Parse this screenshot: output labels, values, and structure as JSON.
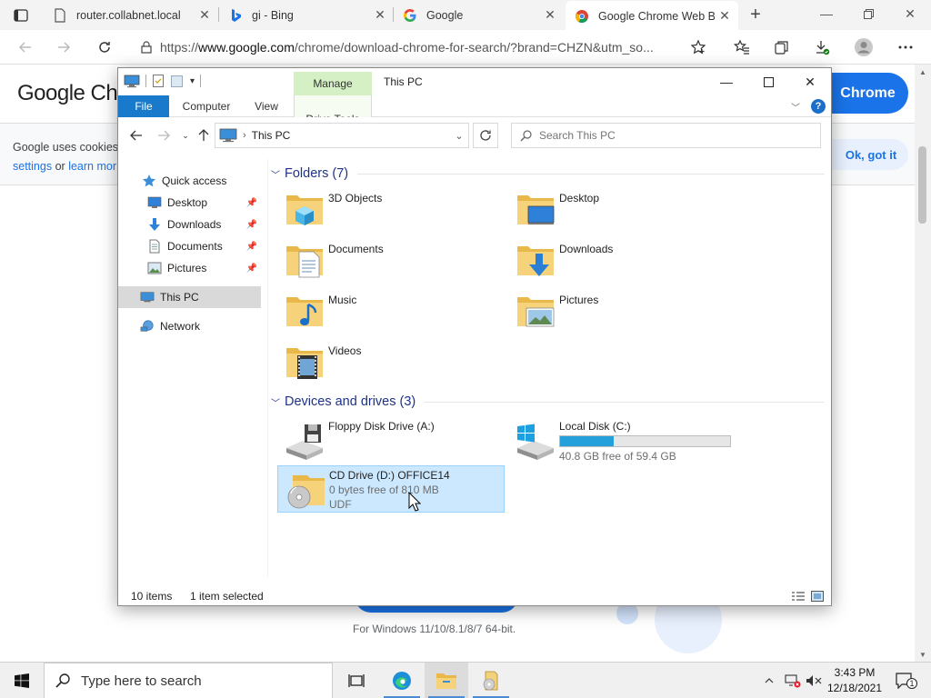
{
  "browser": {
    "tabs": [
      {
        "title": "router.collabnet.local",
        "icon": "page-icon"
      },
      {
        "title": "gi - Bing",
        "icon": "bing-icon"
      },
      {
        "title": "Google",
        "icon": "google-icon"
      },
      {
        "title": "Google Chrome Web B",
        "icon": "chrome-icon"
      }
    ],
    "url_prefix": "https://",
    "url_host": "www.google.com",
    "url_rest": "/chrome/download-chrome-for-search/?brand=CHZN&utm_so..."
  },
  "webpage": {
    "logo": "Google Ch",
    "cookie_line1": "Google uses cookies",
    "cookie_link1": "settings",
    "cookie_or": "or",
    "cookie_link2": "learn mor",
    "cta_label": "Chrome",
    "ok_label": "Ok, got it",
    "platforms": "For Windows 11/10/8.1/8/7 64-bit."
  },
  "explorer": {
    "title": "This PC",
    "manage_tab": "Manage",
    "ribbon_tabs": {
      "file": "File",
      "computer": "Computer",
      "view": "View",
      "drive_tools": "Drive Tools"
    },
    "address_path": "This PC",
    "search_placeholder": "Search This PC",
    "nav": {
      "quick_access": "Quick access",
      "desktop": "Desktop",
      "downloads": "Downloads",
      "documents": "Documents",
      "pictures": "Pictures",
      "this_pc": "This PC",
      "network": "Network"
    },
    "folders_header": "Folders (7)",
    "folders": [
      {
        "name": "3D Objects"
      },
      {
        "name": "Desktop"
      },
      {
        "name": "Documents"
      },
      {
        "name": "Downloads"
      },
      {
        "name": "Music"
      },
      {
        "name": "Pictures"
      },
      {
        "name": "Videos"
      }
    ],
    "devices_header": "Devices and drives (3)",
    "drives": {
      "floppy": {
        "name": "Floppy Disk Drive (A:)"
      },
      "local": {
        "name": "Local Disk (C:)",
        "free": "40.8 GB free of 59.4 GB",
        "used_fraction": 0.313
      },
      "cd": {
        "name": "CD Drive (D:) OFFICE14",
        "free": "0 bytes free of 810 MB",
        "fs": "UDF"
      }
    },
    "status": {
      "items": "10 items",
      "selected": "1 item selected"
    }
  },
  "taskbar": {
    "search_placeholder": "Type here to search",
    "time": "3:43 PM",
    "date": "12/18/2021",
    "notification_count": "1"
  },
  "colors": {
    "accent": "#1979ca",
    "manage_tab": "#d5f0c4",
    "selection": "#cce8ff",
    "drive_bar": "#26a0da",
    "google_blue": "#1a73e8"
  }
}
